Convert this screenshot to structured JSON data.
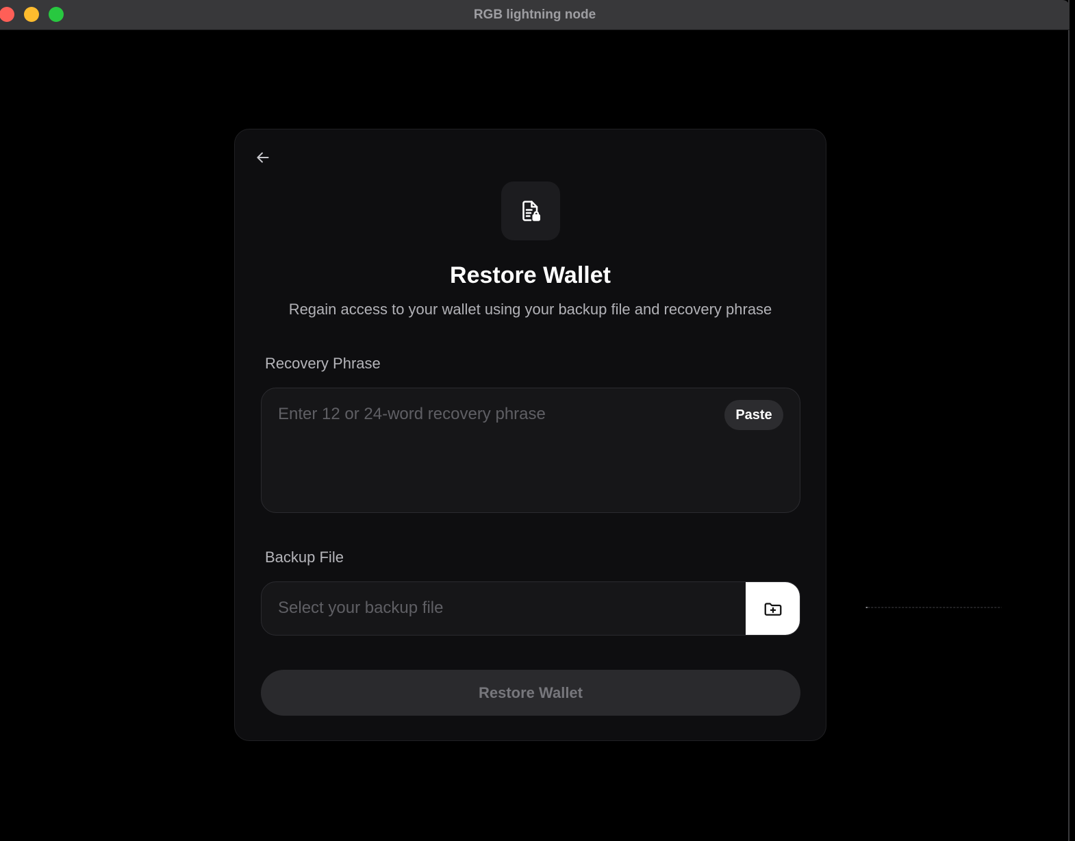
{
  "window": {
    "title": "RGB lightning node",
    "traffic_colors": {
      "close": "#ff5f57",
      "minimize": "#febc2e",
      "maximize": "#28c840"
    }
  },
  "card": {
    "back_icon": "arrow-left-icon",
    "hero_icon": "file-lock-icon",
    "title": "Restore Wallet",
    "subtitle": "Regain access to your wallet using your backup file and recovery phrase"
  },
  "recovery_phrase": {
    "label": "Recovery Phrase",
    "value": "",
    "placeholder": "Enter 12 or 24-word recovery phrase",
    "paste_label": "Paste"
  },
  "backup_file": {
    "label": "Backup File",
    "placeholder": "Select your backup file",
    "browse_icon": "folder-plus-icon"
  },
  "restore_button": {
    "label": "Restore Wallet",
    "disabled": true
  },
  "colors": {
    "background": "#000000",
    "card": "#0e0e10",
    "input_bg": "#161618",
    "button_disabled": "#2a2a2d",
    "accent_white": "#ffffff"
  }
}
